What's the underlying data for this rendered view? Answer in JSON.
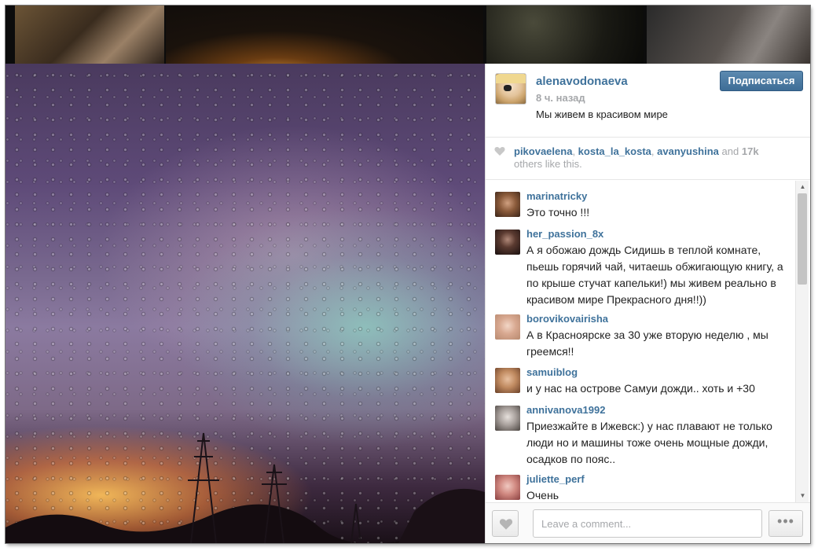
{
  "post": {
    "owner": "alenavodonaeva",
    "time_ago": "8 ч. назад",
    "caption": "Мы живем в красивом мире ",
    "follow_label": "Подписаться"
  },
  "likes": {
    "users": [
      "pikovaelena",
      "kosta_la_kosta",
      "avanyushina"
    ],
    "and_text": "and",
    "count": "17k",
    "suffix": "others like this."
  },
  "comments": [
    {
      "user": "marinatricky",
      "text": "Это точно !!!"
    },
    {
      "user": "her_passion_8x",
      "text": "А я обожаю дождь Сидишь в теплой комнате, пьешь горячий чай, читаешь обжигающую книгу, а по крыше стучат капельки!) мы живем реально в красивом мире Прекрасного дня!!))"
    },
    {
      "user": "borovikovairisha",
      "text": "А в Красноярске за 30 уже вторую неделю , мы греемся!!"
    },
    {
      "user": "samuiblog",
      "text": "и у нас на острове Самуи дожди.. хоть и +30"
    },
    {
      "user": "annivanova1992",
      "text": "Приезжайте в Ижевск:) у нас плавают не только люди но и машины тоже очень мощные дожди, осадков по пояс.."
    },
    {
      "user": "juliette_perf",
      "text": "Очень"
    }
  ],
  "composer": {
    "placeholder": "Leave a comment...",
    "more_label": "•••"
  },
  "icons": {
    "heart": "heart-icon",
    "more": "more-options-icon"
  },
  "colors": {
    "username": "#3f729b",
    "follow_button": "#3e6d96",
    "muted": "#a5a7aa"
  }
}
